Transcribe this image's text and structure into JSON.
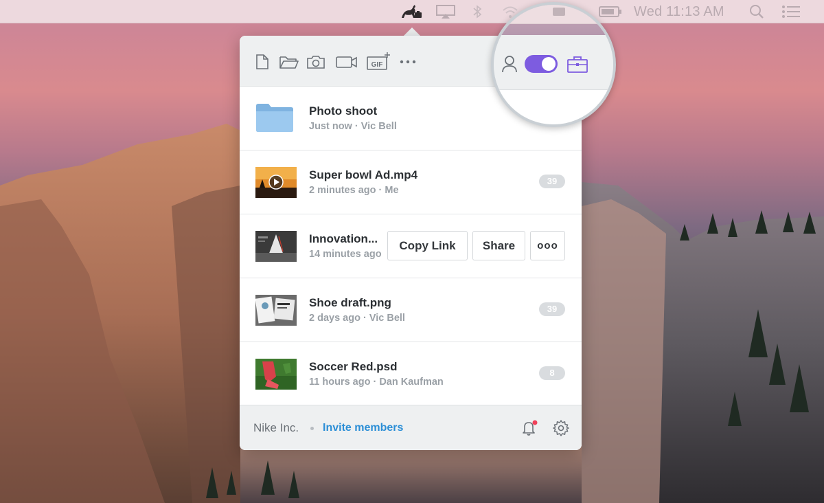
{
  "menubar": {
    "clock": "Wed 11:13 AM",
    "icons": [
      "app-kangaroo-icon",
      "airplay-icon",
      "bluetooth-icon",
      "wifi-icon",
      "battery-icon",
      "spotlight-search-icon",
      "notification-center-icon"
    ]
  },
  "toolbar": {
    "tools": [
      "new-file-icon",
      "folder-icon",
      "camera-icon",
      "video-camera-icon",
      "gif-icon",
      "more-icon"
    ],
    "gif_label": "GIF",
    "accounts": [
      "personal-account-icon",
      "work-toggle",
      "work-briefcase-icon"
    ],
    "toggle_on": true,
    "accent": "#7d5ce0"
  },
  "files": [
    {
      "name": "Photo shoot",
      "meta": "Just now · Vic Bell",
      "count": ""
    },
    {
      "name": "Super bowl Ad.mp4",
      "meta": "2 minutes ago · Me",
      "count": "39"
    },
    {
      "name": "Innovation...",
      "meta": "14 minutes ago",
      "count": ""
    },
    {
      "name": "Shoe draft.png",
      "meta": "2 days ago · Vic Bell",
      "count": "39"
    },
    {
      "name": "Soccer Red.psd",
      "meta": "11 hours ago · Dan Kaufman",
      "count": "8"
    }
  ],
  "row_actions": {
    "copy_link": "Copy Link",
    "share": "Share",
    "more": "ooo"
  },
  "footer": {
    "org": "Nike Inc.",
    "invite": "Invite members",
    "notification_dot_color": "#f0415a"
  },
  "colors": {
    "folder": "#8ec0ea",
    "link": "#2b8ed6"
  }
}
